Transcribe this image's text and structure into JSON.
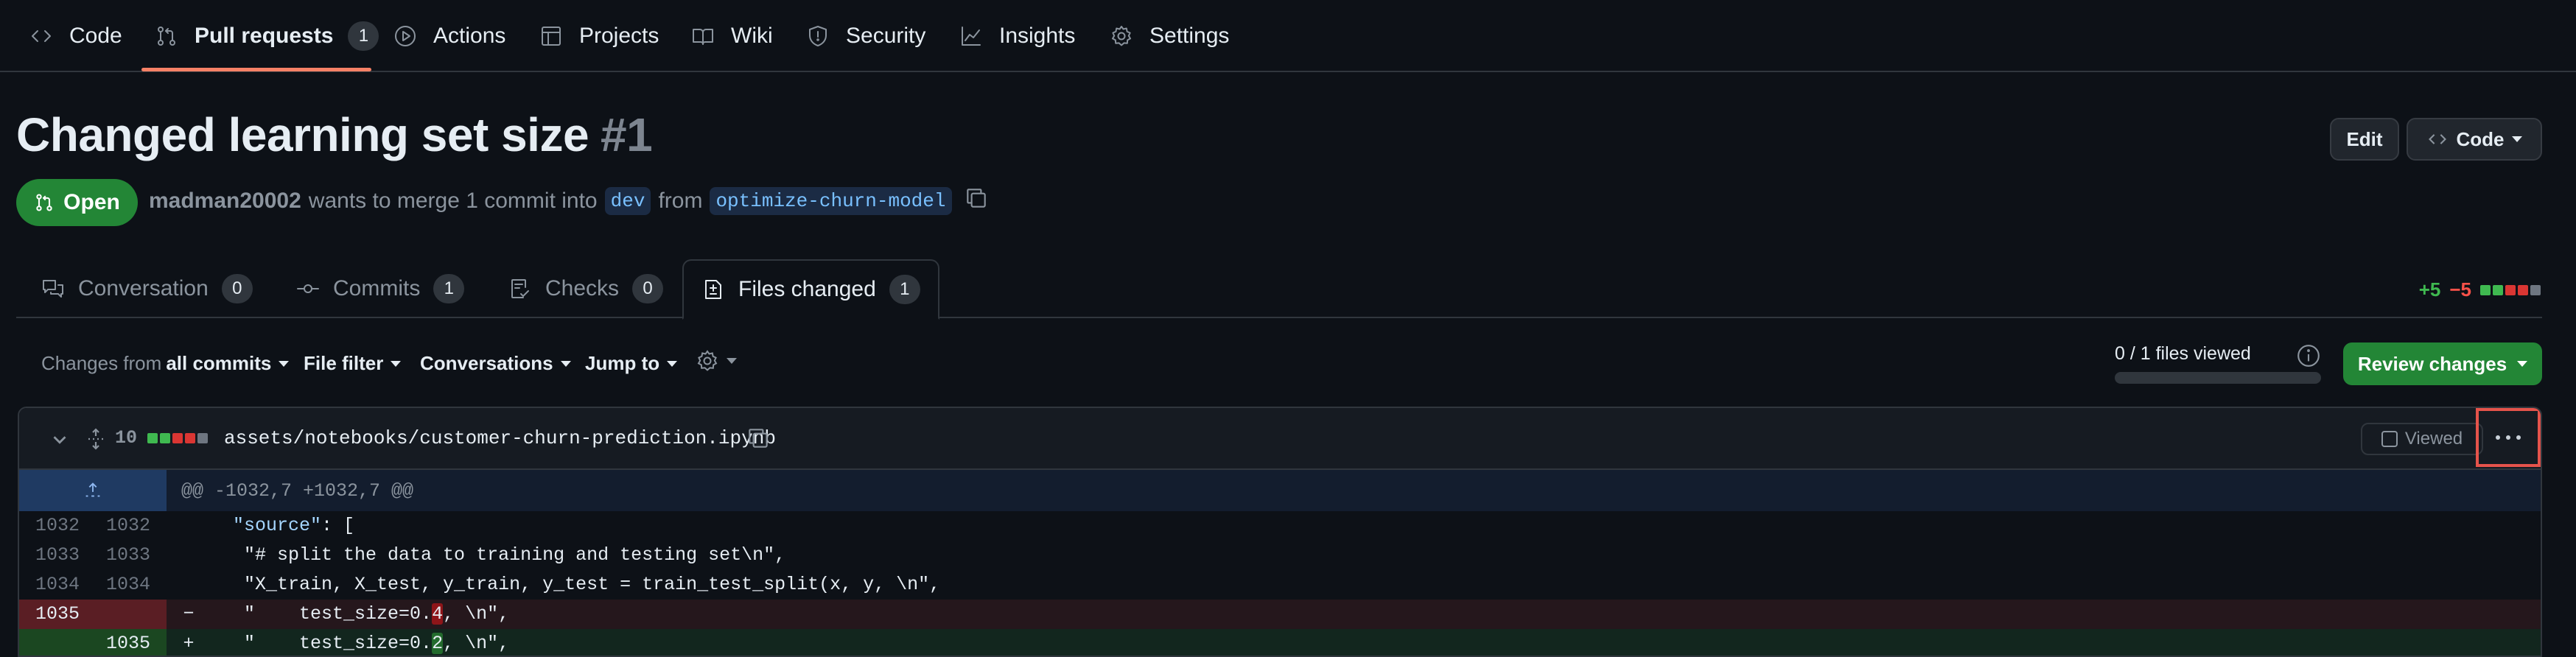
{
  "repo_nav": {
    "items": [
      {
        "label": "Code",
        "icon": "code-icon"
      },
      {
        "label": "Pull requests",
        "icon": "git-pull-request-icon",
        "count": "1",
        "active": true
      },
      {
        "label": "Actions",
        "icon": "play-icon"
      },
      {
        "label": "Projects",
        "icon": "table-icon"
      },
      {
        "label": "Wiki",
        "icon": "book-icon"
      },
      {
        "label": "Security",
        "icon": "shield-icon"
      },
      {
        "label": "Insights",
        "icon": "graph-icon"
      },
      {
        "label": "Settings",
        "icon": "gear-icon"
      }
    ]
  },
  "pr": {
    "title": "Changed learning set size",
    "number": "#1",
    "state": "Open",
    "author": "madman20002",
    "merge_text_1": "wants to merge 1 commit into",
    "base_branch": "dev",
    "merge_text_2": "from",
    "head_branch": "optimize-churn-model"
  },
  "header_buttons": {
    "edit": "Edit",
    "code": "Code"
  },
  "tabs": [
    {
      "label": "Conversation",
      "count": "0",
      "icon": "comment-discussion-icon"
    },
    {
      "label": "Commits",
      "count": "1",
      "icon": "git-commit-icon"
    },
    {
      "label": "Checks",
      "count": "0",
      "icon": "checklist-icon"
    },
    {
      "label": "Files changed",
      "count": "1",
      "icon": "file-diff-icon",
      "active": true
    }
  ],
  "diffstat": {
    "additions": "+5",
    "deletions": "−5"
  },
  "toolbar": {
    "changes_from_prefix": "Changes from",
    "changes_from_value": "all commits",
    "file_filter": "File filter",
    "conversations": "Conversations",
    "jump_to": "Jump to",
    "files_viewed": "0 / 1 files viewed",
    "files_viewed_fraction": 0,
    "review_changes": "Review changes"
  },
  "file": {
    "changes_count": "10",
    "path": "assets/notebooks/customer-churn-prediction.ipynb",
    "viewed_label": "Viewed",
    "hunk_header": "@@ -1032,7 +1032,7 @@",
    "lines": [
      {
        "type": "context",
        "old": "1032",
        "new": "1032",
        "sign": "",
        "pre": "  ",
        "key": "\"source\"",
        "text": ": ["
      },
      {
        "type": "context",
        "old": "1033",
        "new": "1033",
        "sign": "",
        "pre": "   ",
        "key": "",
        "text": "\"# split the data to training and testing set\\n\","
      },
      {
        "type": "context",
        "old": "1034",
        "new": "1034",
        "sign": "",
        "pre": "   ",
        "key": "",
        "text": "\"X_train, X_test, y_train, y_test = train_test_split(x, y, \\n\","
      },
      {
        "type": "del",
        "old": "1035",
        "new": "",
        "sign": "−",
        "pre": "   ",
        "before": "\"    test_size=0.",
        "hl": "4",
        "after": ", \\n\","
      },
      {
        "type": "add",
        "old": "",
        "new": "1035",
        "sign": "+",
        "pre": "   ",
        "before": "\"    test_size=0.",
        "hl": "2",
        "after": ", \\n\","
      }
    ]
  },
  "colors": {
    "accent_underline": "#f78166",
    "open_green": "#238636",
    "highlight_box": "#e5534b"
  }
}
